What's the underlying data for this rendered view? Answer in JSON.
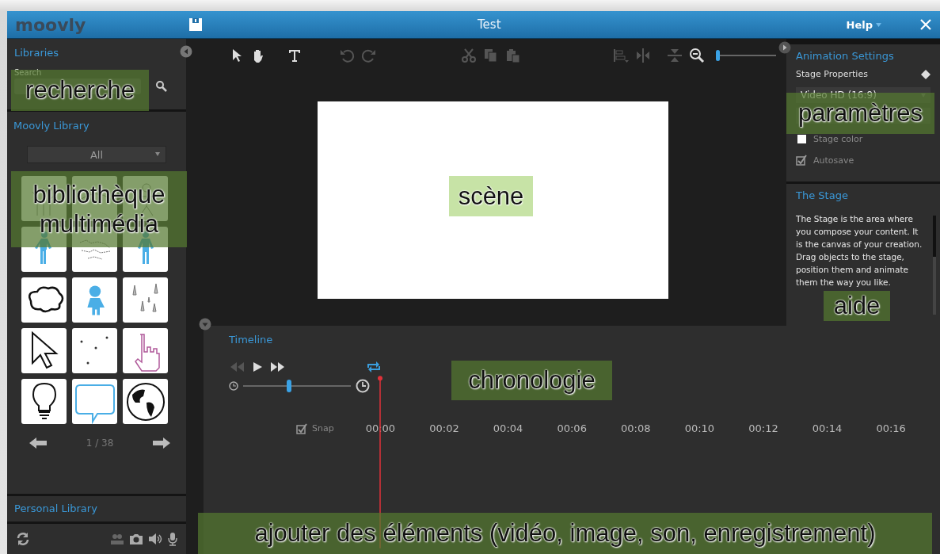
{
  "window": {
    "logo": "moovly",
    "title": "Test",
    "help_menu": "Help"
  },
  "libraries": {
    "title": "Libraries",
    "search": {
      "placeholder": "Search"
    },
    "moovly_library": {
      "title": "Moovly Library",
      "filter": "All",
      "page": "1 / 38"
    },
    "personal_library": {
      "title": "Personal Library"
    }
  },
  "toolbar": {
    "zoom": {
      "level": 0.0
    }
  },
  "animation_settings": {
    "title": "Animation Settings",
    "section": "Stage Properties",
    "format": "Video HD (16:9)",
    "options": [
      {
        "label": "Stage color",
        "checked": false
      },
      {
        "label": "Autosave",
        "checked": true
      }
    ]
  },
  "help": {
    "title": "The Stage",
    "text": "The Stage is the area where you compose your content. It is the canvas of your creation. Drag objects to the stage, position them and animate them the way you like."
  },
  "timeline": {
    "title": "Timeline",
    "zoom": {
      "level": 0.43
    },
    "snap": {
      "label": "Snap",
      "checked": true
    },
    "ticks": [
      "00:00",
      "00:02",
      "00:04",
      "00:06",
      "00:08",
      "00:10",
      "00:12",
      "00:14",
      "00:16"
    ]
  },
  "annotations": [
    {
      "text": "recherche",
      "kind": "dark"
    },
    {
      "text": "bibliothèque multimédia",
      "kind": "dark"
    },
    {
      "text": "scène",
      "kind": "light"
    },
    {
      "text": "paramètres",
      "kind": "dark"
    },
    {
      "text": "aide",
      "kind": "dark"
    },
    {
      "text": "chronologie",
      "kind": "dark"
    },
    {
      "text": "ajouter des éléments (vidéo, image, son, enregistrement)",
      "kind": "dark"
    }
  ]
}
